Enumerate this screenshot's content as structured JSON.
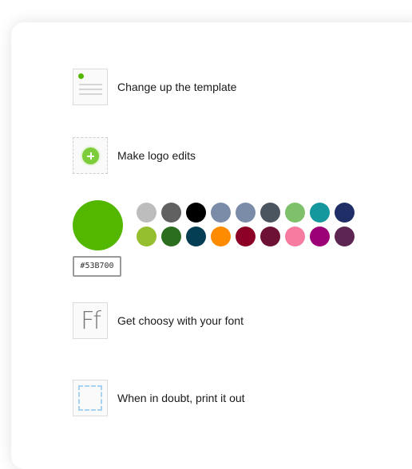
{
  "options": {
    "template": {
      "label": "Change up the template",
      "icon": "template-icon"
    },
    "logo": {
      "label": "Make logo edits",
      "icon": "logo-add-icon"
    },
    "font": {
      "label": "Get choosy with your font",
      "icon": "font-icon",
      "preview": "Ff"
    },
    "print": {
      "label": "When in doubt, print it out",
      "icon": "print-icon"
    }
  },
  "color": {
    "selected": "#53B700",
    "hex_value": "#53B700",
    "palette": [
      "#BDBDBD",
      "#616161",
      "#000000",
      "#7A8CA8",
      "#7A8CA8",
      "#4A5560",
      "#7EC16A",
      "#15979E",
      "#1F2E66",
      "#95BF2E",
      "#2B6E1F",
      "#043E54",
      "#FF8C00",
      "#8C0025",
      "#6E1235",
      "#F57BA0",
      "#9C0077",
      "#5C2552"
    ]
  }
}
